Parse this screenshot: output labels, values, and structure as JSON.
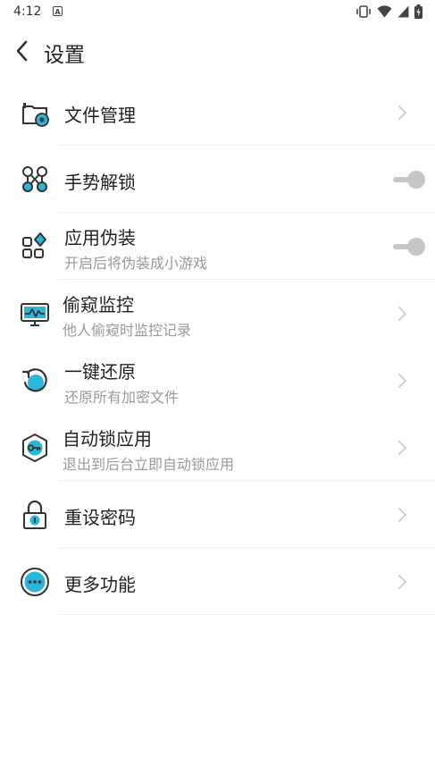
{
  "status_bar": {
    "time": "4:12",
    "notification_icon": "A",
    "icons": [
      "vibrate-icon",
      "wifi-icon",
      "signal-icon",
      "battery-icon"
    ]
  },
  "header": {
    "title": "设置",
    "back_icon": "chevron-left-icon"
  },
  "accent_color": "#29b6d8",
  "items": [
    {
      "title": "文件管理",
      "subtitle": "",
      "control": "chevron",
      "icon": "folder-camera-icon"
    },
    {
      "title": "手势解锁",
      "subtitle": "",
      "control": "toggle",
      "enabled": false,
      "icon": "gesture-pattern-icon"
    },
    {
      "title": "应用伪装",
      "subtitle": "开启后将伪装成小游戏",
      "control": "toggle",
      "enabled": false,
      "icon": "app-grid-icon"
    },
    {
      "title": "偷窥监控",
      "subtitle": "他人偷窥时监控记录",
      "control": "chevron",
      "icon": "monitor-icon"
    },
    {
      "title": "一键还原",
      "subtitle": "还原所有加密文件",
      "control": "chevron",
      "icon": "restore-icon"
    },
    {
      "title": "自动锁应用",
      "subtitle": "退出到后台立即自动锁应用",
      "control": "chevron",
      "icon": "key-shield-icon"
    },
    {
      "title": "重设密码",
      "subtitle": "",
      "control": "chevron",
      "icon": "lock-icon"
    },
    {
      "title": "更多功能",
      "subtitle": "",
      "control": "chevron",
      "icon": "more-dots-icon"
    }
  ]
}
